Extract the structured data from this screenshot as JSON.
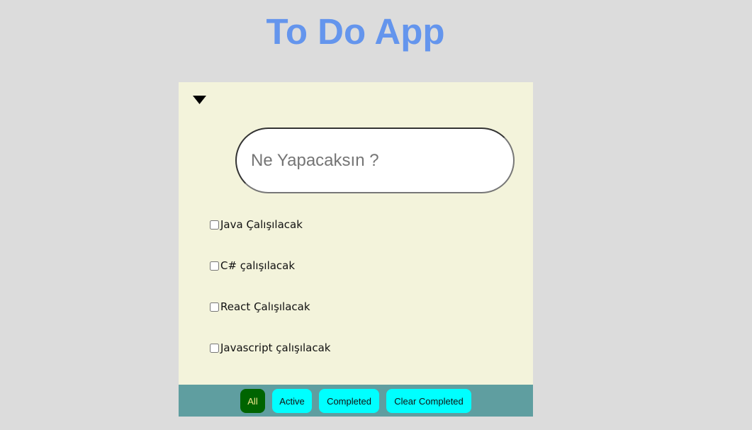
{
  "app": {
    "title": "To Do App"
  },
  "new_todo": {
    "placeholder": "Ne Yapacaksın ?",
    "value": ""
  },
  "todos": [
    {
      "label": "Java Çalışılacak",
      "completed": false
    },
    {
      "label": "C# çalışılacak",
      "completed": false
    },
    {
      "label": "React Çalışılacak",
      "completed": false
    },
    {
      "label": "Javascript çalışılacak",
      "completed": false
    }
  ],
  "footer": {
    "filter_all": "All",
    "filter_active": "Active",
    "filter_completed": "Completed",
    "clear_completed": "Clear Completed",
    "selected_filter": "All"
  },
  "icons": {
    "toggle_all": "triangle-down-icon"
  },
  "colors": {
    "page_background": "#dcdcdc",
    "title": "#6495ed",
    "card_background": "#f3f3db",
    "footer_background": "#5f9ea0",
    "button_background": "#00ffff",
    "selected_button_background": "#006400",
    "selected_button_text": "#f0e68c"
  }
}
